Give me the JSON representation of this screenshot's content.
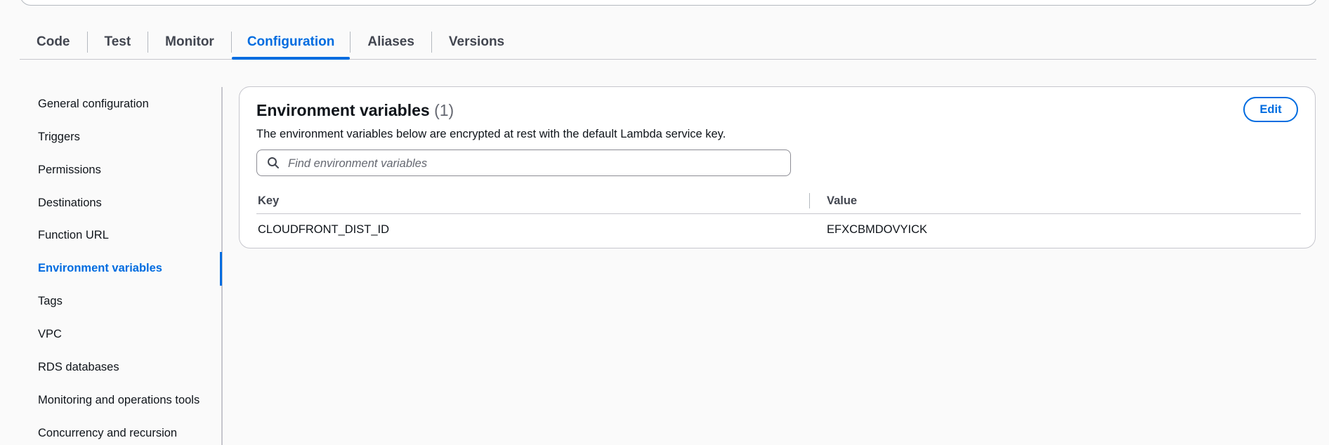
{
  "tabs": [
    {
      "label": "Code"
    },
    {
      "label": "Test"
    },
    {
      "label": "Monitor"
    },
    {
      "label": "Configuration",
      "active": true
    },
    {
      "label": "Aliases"
    },
    {
      "label": "Versions"
    }
  ],
  "side_nav": {
    "items": [
      {
        "label": "General configuration"
      },
      {
        "label": "Triggers"
      },
      {
        "label": "Permissions"
      },
      {
        "label": "Destinations"
      },
      {
        "label": "Function URL"
      },
      {
        "label": "Environment variables",
        "active": true
      },
      {
        "label": "Tags"
      },
      {
        "label": "VPC"
      },
      {
        "label": "RDS databases"
      },
      {
        "label": "Monitoring and operations tools"
      },
      {
        "label": "Concurrency and recursion"
      }
    ]
  },
  "env_panel": {
    "title": "Environment variables",
    "count": "(1)",
    "description": "The environment variables below are encrypted at rest with the default Lambda service key.",
    "edit_label": "Edit",
    "search_placeholder": "Find environment variables",
    "search_value": "",
    "columns": {
      "key": "Key",
      "value": "Value"
    },
    "rows": [
      {
        "key": "CLOUDFRONT_DIST_ID",
        "value": "EFXCBMDOVYICK"
      }
    ]
  },
  "colors": {
    "accent": "#006ce0",
    "text": "#0f141a",
    "border": "#c6c6cd",
    "background": "#fafafa"
  },
  "icons": {
    "search": "search-icon"
  }
}
